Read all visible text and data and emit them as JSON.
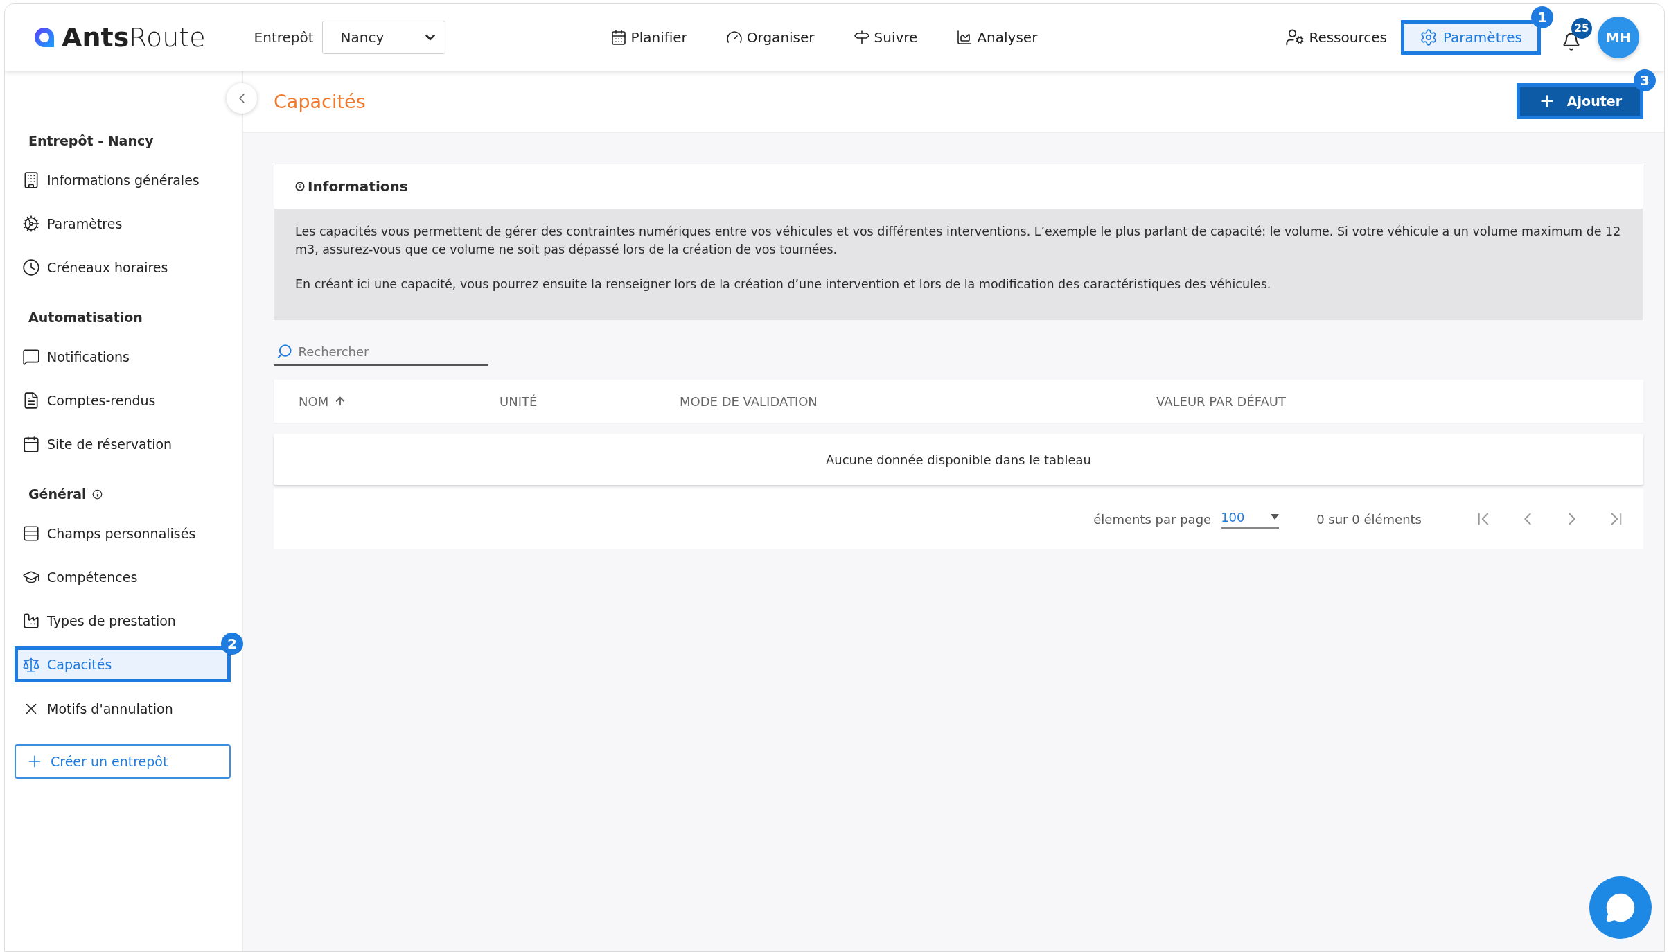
{
  "header": {
    "logo": "**Ants**Route",
    "warehouse_label": "Entrepôt",
    "warehouse_select": "Nancy",
    "nav": [
      {
        "label": "Planifier"
      },
      {
        "label": "Organiser"
      },
      {
        "label": "Suivre"
      },
      {
        "label": "Analyser"
      }
    ],
    "resources": "Ressources",
    "settings": {
      "label": "Paramètres",
      "selected": true,
      "callout": "1"
    },
    "notifications": "25",
    "avatar": "MH"
  },
  "sidebar": {
    "groups": [
      {
        "title": "Entrepôt - Nancy",
        "has_info": false,
        "items": [
          {
            "label": "Informations générales",
            "selected": false
          },
          {
            "label": "Paramètres",
            "selected": false
          },
          {
            "label": "Créneaux horaires",
            "selected": false
          }
        ]
      },
      {
        "title": "Automatisation",
        "has_info": false,
        "items": [
          {
            "label": "Notifications",
            "selected": false
          },
          {
            "label": "Comptes-rendus",
            "selected": false
          },
          {
            "label": "Site de réservation",
            "selected": false
          }
        ]
      },
      {
        "title": "Général",
        "has_info": true,
        "items": [
          {
            "label": "Champs personnalisés",
            "selected": false
          },
          {
            "label": "Compétences",
            "selected": false
          },
          {
            "label": "Types de prestation",
            "selected": false
          },
          {
            "label": "Capacités",
            "selected": true,
            "callout": "2"
          },
          {
            "label": "Motifs d'annulation",
            "selected": false
          }
        ]
      }
    ],
    "create_button": "Créer un entrepôt"
  },
  "page": {
    "title": "Capacités",
    "add_button": {
      "label": "Ajouter",
      "callout": "3"
    }
  },
  "info": {
    "title": "Informations",
    "paragraphs": [
      "Les capacités vous permettent de gérer des contraintes numériques entre vos véhicules et vos différentes interventions. L’exemple le plus parlant de capacité: le volume. Si votre véhicule a un volume maximum de 12 m3, assurez-vous que ce volume ne soit pas dépassé lors de la création de vos tournées.",
      "En créant ici une capacité, vous pourrez ensuite la renseigner lors de la création d’une intervention et lors de la modification des caractéristiques des véhicules."
    ]
  },
  "search": {
    "placeholder": "Rechercher"
  },
  "table": {
    "columns": [
      {
        "label": "NOM",
        "sorted": true
      },
      {
        "label": "UNITÉ",
        "sorted": false
      },
      {
        "label": "MODE DE VALIDATION",
        "sorted": false
      },
      {
        "label": "VALEUR PAR DÉFAUT",
        "sorted": false
      }
    ],
    "empty_message": "Aucune donnée disponible dans le tableau"
  },
  "pagination": {
    "per_page_label": "élements par page",
    "per_page": "100",
    "summary": "0 sur 0 éléments"
  }
}
